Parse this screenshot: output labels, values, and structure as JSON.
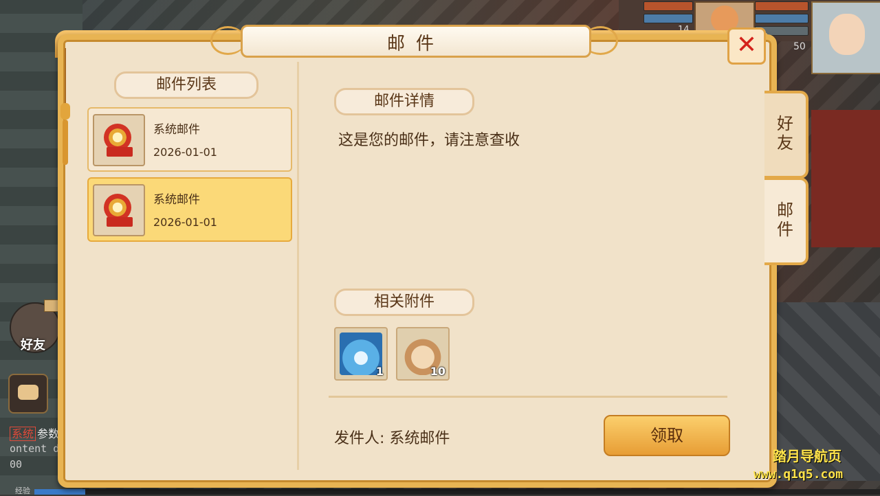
{
  "hud": {
    "level_left": "14",
    "level_right": "50",
    "friend_label": "好友",
    "chat_tag": "系统",
    "chat_line1": "参数",
    "chat_line2": "ontent d",
    "chat_line3": "00",
    "exp_label": "经验",
    "exp_fraction": 0.06
  },
  "panel": {
    "title": "邮件",
    "close_icon": "close-icon",
    "list_title": "邮件列表",
    "mails": [
      {
        "name": "系统邮件",
        "date": "2026-01-01",
        "selected": false
      },
      {
        "name": "系统邮件",
        "date": "2026-01-01",
        "selected": true
      }
    ],
    "detail_title": "邮件详情",
    "detail_text": "这是您的邮件，请注意查收",
    "attachments_title": "相关附件",
    "attachments": [
      {
        "icon": "ice-fan-icon",
        "count": "1"
      },
      {
        "icon": "treasure-bag-icon",
        "count": "10"
      }
    ],
    "sender_label": "发件人: 系统邮件",
    "claim_button": "领取"
  },
  "side_tabs": [
    {
      "label": "好友",
      "active": false
    },
    {
      "label": "邮件",
      "active": true
    }
  ],
  "watermark": {
    "line1": "踏月导航页",
    "line2": "www.q1q5.com"
  },
  "colors": {
    "panel_bg": "#f1e2c9",
    "border_gold": "#e8b453",
    "selected_item": "#fbd978",
    "close_red": "#d4221b"
  }
}
